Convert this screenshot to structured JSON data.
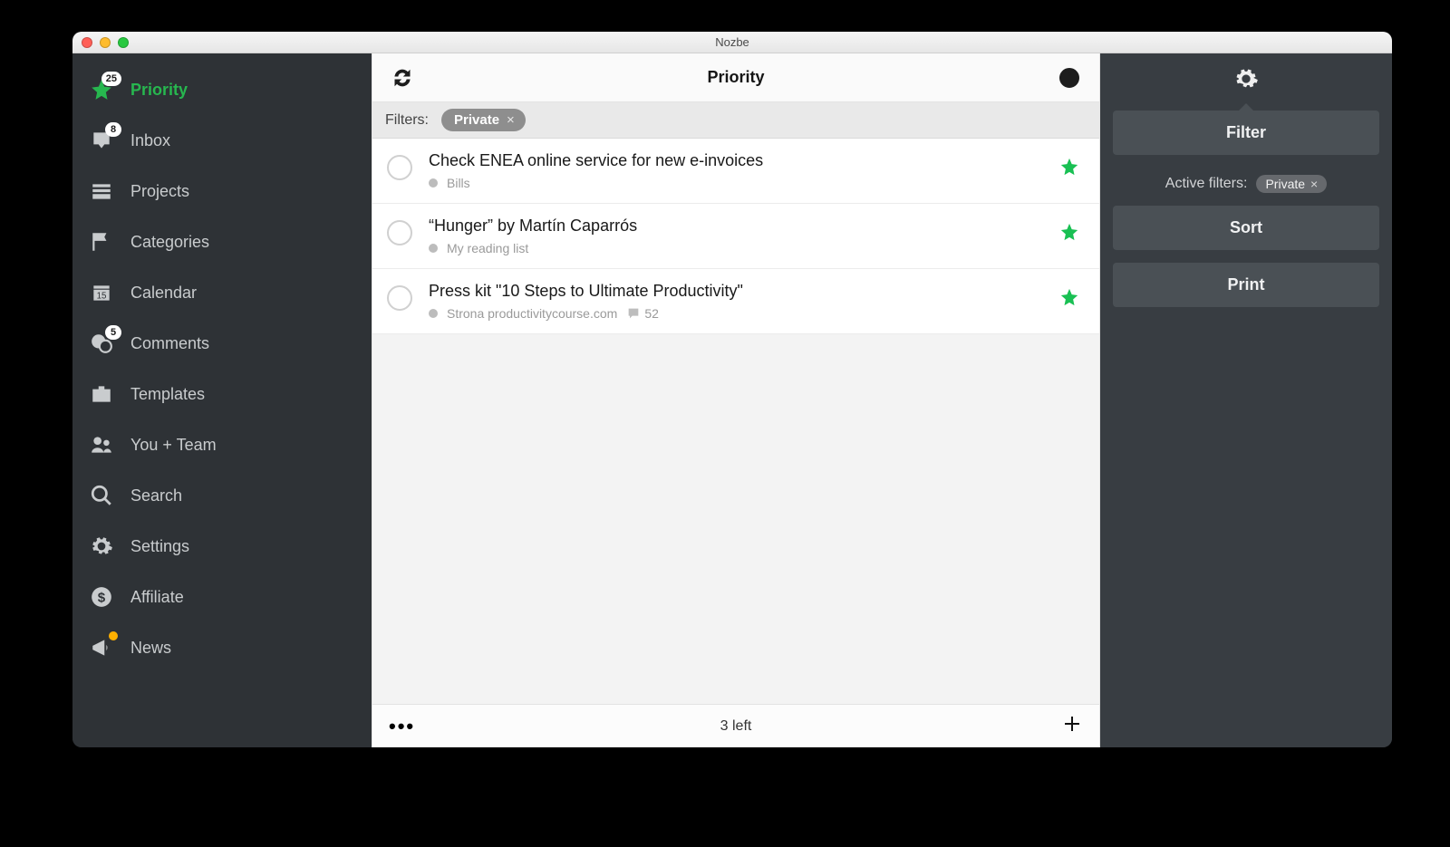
{
  "window": {
    "title": "Nozbe"
  },
  "sidebar": {
    "items": [
      {
        "id": "priority",
        "label": "Priority",
        "badge": "25",
        "active": true
      },
      {
        "id": "inbox",
        "label": "Inbox",
        "badge": "8"
      },
      {
        "id": "projects",
        "label": "Projects"
      },
      {
        "id": "categories",
        "label": "Categories"
      },
      {
        "id": "calendar",
        "label": "Calendar",
        "day": "15"
      },
      {
        "id": "comments",
        "label": "Comments",
        "badge": "5"
      },
      {
        "id": "templates",
        "label": "Templates"
      },
      {
        "id": "team",
        "label": "You + Team"
      },
      {
        "id": "search",
        "label": "Search"
      },
      {
        "id": "settings",
        "label": "Settings"
      },
      {
        "id": "affiliate",
        "label": "Affiliate"
      },
      {
        "id": "news",
        "label": "News",
        "dot": true
      }
    ]
  },
  "main": {
    "title": "Priority",
    "filters_label": "Filters:",
    "filter_chip": "Private",
    "footer_left": "three-dots",
    "footer_text": "3 left",
    "tasks": [
      {
        "title": "Check ENEA online service for new e-invoices",
        "project": "Bills",
        "starred": true
      },
      {
        "title": "“Hunger” by Martín Caparrós",
        "project": "My reading list",
        "starred": true
      },
      {
        "title": "Press kit \"10 Steps to Ultimate Productivity\"",
        "project": "Strona productivitycourse.com",
        "comments": "52",
        "starred": true
      }
    ]
  },
  "rpanel": {
    "filter_btn": "Filter",
    "active_label": "Active filters:",
    "active_chip": "Private",
    "sort_btn": "Sort",
    "print_btn": "Print"
  }
}
